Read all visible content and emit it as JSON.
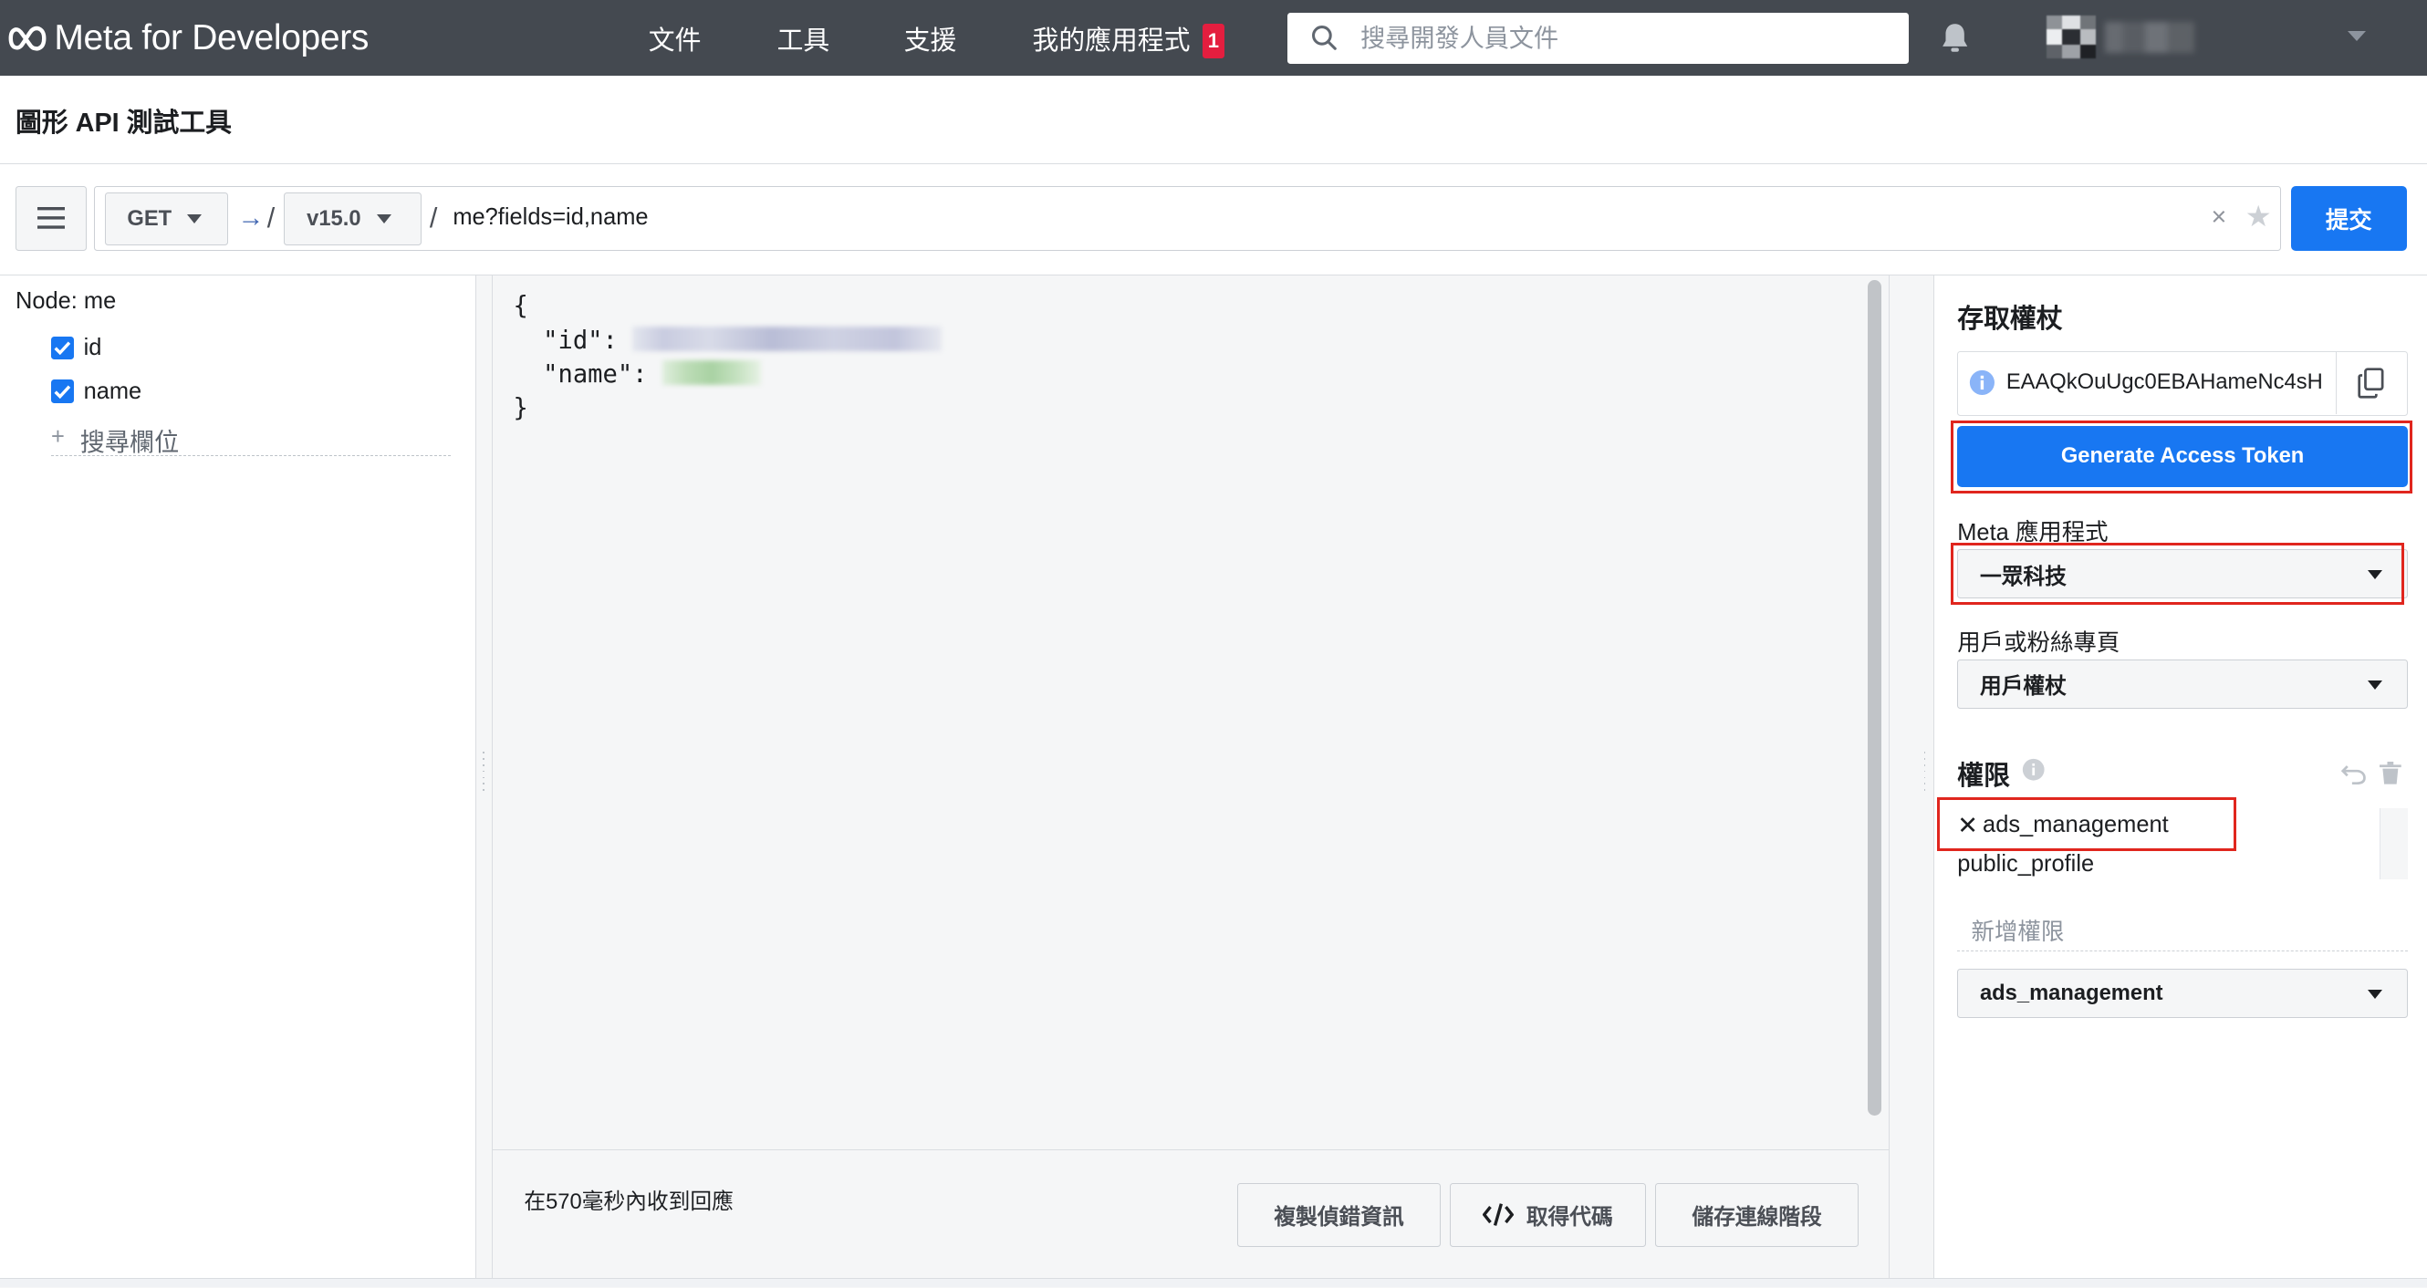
{
  "header": {
    "brand": "Meta for Developers",
    "nav": [
      {
        "label": "文件"
      },
      {
        "label": "工具"
      },
      {
        "label": "支援"
      },
      {
        "label": "我的應用程式",
        "badge": "1"
      }
    ],
    "search_placeholder": "搜尋開發人員文件"
  },
  "page": {
    "title": "圖形 API 測試工具"
  },
  "request": {
    "method": "GET",
    "version": "v15.0",
    "path": "me?fields=id,name",
    "submit_label": "提交"
  },
  "fields_panel": {
    "node_label": "Node: me",
    "fields": [
      {
        "name": "id",
        "checked": true
      },
      {
        "name": "name",
        "checked": true
      }
    ],
    "search_field_placeholder": "搜尋欄位"
  },
  "response": {
    "open_brace": "{",
    "close_brace": "}",
    "id_key": "\"id\": ",
    "name_key": "\"name\": ",
    "time_text": "在570毫秒內收到回應",
    "buttons": {
      "copy_debug": "複製偵錯資訊",
      "get_code": "取得代碼",
      "save_session": "儲存連線階段"
    }
  },
  "token_panel": {
    "title": "存取權杖",
    "token_value": "EAAQkOuUgc0EBAHameNc4sH",
    "generate_label": "Generate Access Token",
    "app_label": "Meta 應用程式",
    "app_selected": "一眾科技",
    "user_page_label": "用戶或粉絲專頁",
    "user_page_selected": "用戶權杖",
    "permissions_title": "權限",
    "permissions": [
      "ads_management",
      "public_profile"
    ],
    "add_permission_placeholder": "新增權限",
    "permission_select_value": "ads_management"
  },
  "colors": {
    "nav_bg": "#444950",
    "primary_blue": "#1877f2",
    "highlight_red": "#e0261e",
    "badge_red": "#e41e3f",
    "panel_bg": "#f5f6f7"
  },
  "icons": [
    "meta-logo-icon",
    "search-icon",
    "bell-icon",
    "hamburger-menu-icon",
    "arrow-right-icon",
    "clear-icon",
    "star-icon",
    "checkbox-checked-icon",
    "plus-icon",
    "info-icon",
    "copy-icon",
    "undo-icon",
    "trash-icon",
    "remove-permission-icon",
    "code-icon",
    "chevron-down-icon"
  ]
}
